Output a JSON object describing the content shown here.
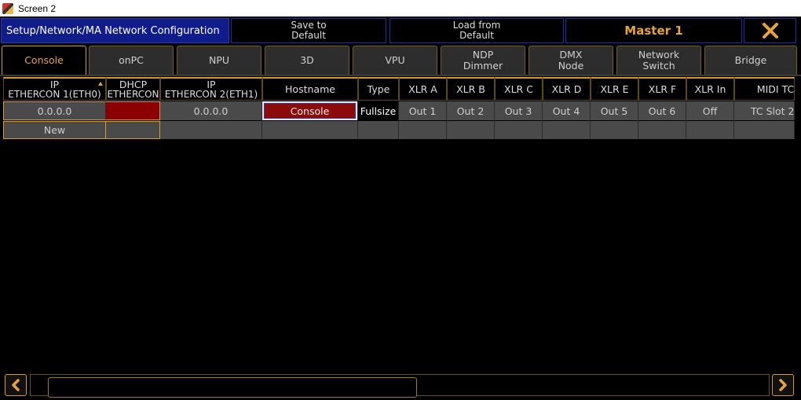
{
  "window": {
    "title": "Screen 2"
  },
  "header": {
    "path": "Setup/Network/MA Network Configuration",
    "save_line1": "Save to",
    "save_line2": "Default",
    "load_line1": "Load from",
    "load_line2": "Default",
    "master": "Master 1",
    "close_icon": "close-x-icon"
  },
  "tabs": [
    {
      "line1": "Console",
      "line2": "",
      "active": true
    },
    {
      "line1": "onPC",
      "line2": ""
    },
    {
      "line1": "NPU",
      "line2": ""
    },
    {
      "line1": "3D",
      "line2": ""
    },
    {
      "line1": "VPU",
      "line2": ""
    },
    {
      "line1": "NDP",
      "line2": "Dimmer"
    },
    {
      "line1": "DMX",
      "line2": "Node"
    },
    {
      "line1": "Network",
      "line2": "Switch"
    },
    {
      "line1": "Bridge",
      "line2": ""
    }
  ],
  "table": {
    "columns": [
      {
        "line1": "IP",
        "line2": "ETHERCON 1(ETH0)"
      },
      {
        "line1": "DHCP",
        "line2": "ETHERCON"
      },
      {
        "line1": "IP",
        "line2": "ETHERCON 2(ETH1)"
      },
      {
        "line1": "Hostname",
        "line2": ""
      },
      {
        "line1": "Type",
        "line2": ""
      },
      {
        "line1": "XLR A",
        "line2": ""
      },
      {
        "line1": "XLR B",
        "line2": ""
      },
      {
        "line1": "XLR C",
        "line2": ""
      },
      {
        "line1": "XLR D",
        "line2": ""
      },
      {
        "line1": "XLR E",
        "line2": ""
      },
      {
        "line1": "XLR F",
        "line2": ""
      },
      {
        "line1": "XLR In",
        "line2": ""
      },
      {
        "line1": "MIDI TC",
        "line2": ""
      }
    ],
    "rows": [
      [
        "0.0.0.0",
        "",
        "0.0.0.0",
        "Console",
        "Fullsize",
        "Out 1",
        "Out 2",
        "Out 3",
        "Out 4",
        "Out 5",
        "Out 6",
        "Off",
        "TC Slot 2"
      ],
      [
        "New",
        "",
        "",
        "",
        "",
        "",
        "",
        "",
        "",
        "",
        "",
        "",
        ""
      ]
    ]
  },
  "colors": {
    "accent": "#e7a33c",
    "header_blue": "#101c8a",
    "dhcp_red": "#8b0000",
    "hostname_red": "#8b0a0a"
  },
  "scroll": {
    "left_icon": "chevron-left-icon",
    "right_icon": "chevron-right-icon"
  }
}
